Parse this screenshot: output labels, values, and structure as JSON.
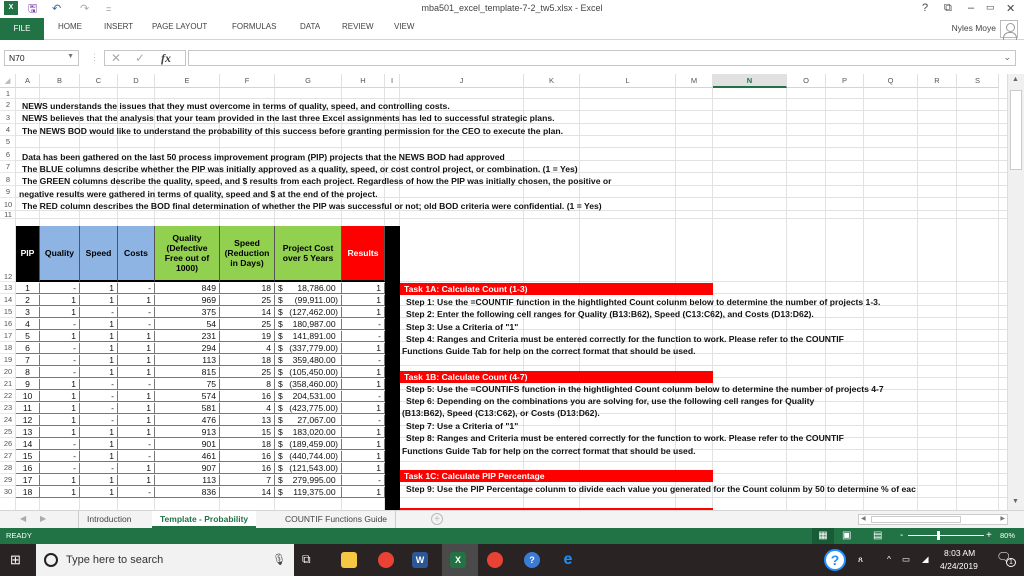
{
  "window": {
    "title": "mba501_excel_template-7-2_tw5.xlsx - Excel",
    "user_name": "Nyles Moye",
    "help": "?",
    "controls": {
      "restore_ribbon": "⧉",
      "minimize": "–",
      "maximize": "🗗",
      "close": "✕"
    }
  },
  "quick_access": {
    "save_icon": "save-icon",
    "undo_icon": "undo-icon",
    "redo_icon": "redo-icon",
    "customize": "="
  },
  "ribbon": {
    "tabs": [
      "FILE",
      "HOME",
      "INSERT",
      "PAGE LAYOUT",
      "FORMULAS",
      "DATA",
      "REVIEW",
      "VIEW"
    ]
  },
  "formula_bar": {
    "name_box": "N70",
    "cancel": "✕",
    "enter": "✓",
    "fx": "fx",
    "formula": ""
  },
  "columns": [
    "A",
    "B",
    "C",
    "D",
    "E",
    "F",
    "G",
    "H",
    "I",
    "J",
    "K",
    "L",
    "M",
    "N",
    "O",
    "P",
    "Q",
    "R",
    "S"
  ],
  "selected_column": "N",
  "rows": [
    "1",
    "2",
    "3",
    "4",
    "5",
    "6",
    "7",
    "8",
    "9",
    "10",
    "11",
    "12",
    "13",
    "14",
    "15",
    "16",
    "17",
    "18",
    "19",
    "20",
    "21",
    "22",
    "23",
    "24",
    "25",
    "26",
    "27",
    "28",
    "29",
    "30"
  ],
  "intro_lines": {
    "r2": "NEWS understands the issues that they must overcome in terms of quality, speed, and controlling costs.",
    "r3": "NEWS believes that the analysis that your team provided in the last three Excel assignments has led to successful strategic plans.",
    "r4": "The NEWS BOD would like to understand the probability of this success before granting permission for the CEO to execute the plan.",
    "r6": "Data has been gathered on the last 50 process improvement program (PIP) projects that the NEWS BOD had approved",
    "r7": "The BLUE columns describe whether the PIP was initially approved as a quality, speed, or cost control project, or combination. (1 = Yes)",
    "r8": "The GREEN columns describe the quality, speed, and $ results from each project. Regardless of how the PIP was initially chosen, the positive or",
    "r9": "negative results were gathered in terms of quality, speed and $ at the end of the project.",
    "r10": "The RED column describes the BOD final determination of whether the PIP was successful or not; old BOD criteria were confidential. (1 = Yes)"
  },
  "table": {
    "headers": {
      "pip": "PIP",
      "quality": "Quality",
      "speed": "Speed",
      "costs": "Costs",
      "quality_result": "Quality (Defective Free out of 1000)",
      "speed_result": "Speed (Reduction in Days)",
      "cost_result": "Project Cost over 5 Years",
      "results": "Results"
    },
    "colors": {
      "pip": "#000000",
      "blue": "#8db4e2",
      "green": "#92d050",
      "red": "#ff0000"
    },
    "rows": [
      {
        "pip": "1",
        "quality": "-",
        "speed": "1",
        "costs": "-",
        "q": "849",
        "s": "18",
        "cost_sym": "$",
        "cost": "18,786.00 ",
        "result": "1"
      },
      {
        "pip": "2",
        "quality": "1",
        "speed": "1",
        "costs": "1",
        "q": "969",
        "s": "25",
        "cost_sym": "$",
        "cost": "(99,911.00)",
        "result": "1"
      },
      {
        "pip": "3",
        "quality": "1",
        "speed": "-",
        "costs": "-",
        "q": "375",
        "s": "14",
        "cost_sym": "$",
        "cost": "(127,462.00)",
        "result": "1"
      },
      {
        "pip": "4",
        "quality": "-",
        "speed": "1",
        "costs": "-",
        "q": "54",
        "s": "25",
        "cost_sym": "$",
        "cost": "180,987.00 ",
        "result": "-"
      },
      {
        "pip": "5",
        "quality": "1",
        "speed": "1",
        "costs": "1",
        "q": "231",
        "s": "19",
        "cost_sym": "$",
        "cost": "141,891.00 ",
        "result": "-"
      },
      {
        "pip": "6",
        "quality": "-",
        "speed": "1",
        "costs": "1",
        "q": "294",
        "s": "4",
        "cost_sym": "$",
        "cost": "(337,779.00)",
        "result": "1"
      },
      {
        "pip": "7",
        "quality": "-",
        "speed": "1",
        "costs": "1",
        "q": "113",
        "s": "18",
        "cost_sym": "$",
        "cost": "359,480.00 ",
        "result": "-"
      },
      {
        "pip": "8",
        "quality": "-",
        "speed": "1",
        "costs": "1",
        "q": "815",
        "s": "25",
        "cost_sym": "$",
        "cost": "(105,450.00)",
        "result": "1"
      },
      {
        "pip": "9",
        "quality": "1",
        "speed": "-",
        "costs": "-",
        "q": "75",
        "s": "8",
        "cost_sym": "$",
        "cost": "(358,460.00)",
        "result": "1"
      },
      {
        "pip": "10",
        "quality": "1",
        "speed": "-",
        "costs": "1",
        "q": "574",
        "s": "16",
        "cost_sym": "$",
        "cost": "204,531.00 ",
        "result": "-"
      },
      {
        "pip": "11",
        "quality": "1",
        "speed": "-",
        "costs": "1",
        "q": "581",
        "s": "4",
        "cost_sym": "$",
        "cost": "(423,775.00)",
        "result": "1"
      },
      {
        "pip": "12",
        "quality": "1",
        "speed": "-",
        "costs": "1",
        "q": "476",
        "s": "13",
        "cost_sym": "$",
        "cost": "27,067.00 ",
        "result": "-"
      },
      {
        "pip": "13",
        "quality": "1",
        "speed": "1",
        "costs": "1",
        "q": "913",
        "s": "15",
        "cost_sym": "$",
        "cost": "183,020.00 ",
        "result": "1"
      },
      {
        "pip": "14",
        "quality": "-",
        "speed": "1",
        "costs": "-",
        "q": "901",
        "s": "18",
        "cost_sym": "$",
        "cost": "(189,459.00)",
        "result": "1"
      },
      {
        "pip": "15",
        "quality": "-",
        "speed": "1",
        "costs": "-",
        "q": "461",
        "s": "16",
        "cost_sym": "$",
        "cost": "(440,744.00)",
        "result": "1"
      },
      {
        "pip": "16",
        "quality": "-",
        "speed": "-",
        "costs": "1",
        "q": "907",
        "s": "16",
        "cost_sym": "$",
        "cost": "(121,543.00)",
        "result": "1"
      },
      {
        "pip": "17",
        "quality": "1",
        "speed": "1",
        "costs": "1",
        "q": "113",
        "s": "7",
        "cost_sym": "$",
        "cost": "279,995.00 ",
        "result": "-"
      },
      {
        "pip": "18",
        "quality": "1",
        "speed": "1",
        "costs": "-",
        "q": "836",
        "s": "14",
        "cost_sym": "$",
        "cost": "119,375.00 ",
        "result": "1"
      }
    ]
  },
  "tasks": {
    "t1a": {
      "title": "Task 1A:  Calculate Count (1-3)",
      "lines": [
        "Step 1: Use the =COUNTIF function in the hightlighted Count colunm below to determine the number of projects 1-3.",
        "Step 2: Enter the following cell ranges for Quality (B13:B62), Speed (C13:C62), and Costs (D13:D62).",
        "Step 3: Use a Criteria of \"1\"",
        "Step 4: Ranges and Criteria must be entered correctly for the function to work. Please refer to the COUNTIF",
        "Functions Guide Tab for help on the correct format that should be used."
      ]
    },
    "t1b": {
      "title": "Task 1B:  Calculate Count (4-7)",
      "lines": [
        "Step 5: Use the =COUNTIFS function in the hightlighted Count colunm below to determine the number of projects 4-7",
        "Step 6: Depending on the combinations you are solving for, use the following cell ranges for Quality",
        "(B13:B62), Speed (C13:C62), or Costs (D13:D62).",
        "Step 7: Use a Criteria of \"1\"",
        "Step 8: Ranges and Criteria must be entered correctly for the function to work. Please refer to the COUNTIF",
        "Functions Guide Tab for help on the correct format that should be used."
      ]
    },
    "t1c": {
      "title": "Task 1C:  Calculate PIP Percentage",
      "lines": [
        "Step 9: Use the PIP Percentage colunm to divide each value you generated for the Count colunm by 50 to determine % of eac"
      ]
    }
  },
  "sheet_tabs": [
    "Introduction",
    "Template - Probability",
    "COUNTIF Functions Guide"
  ],
  "active_sheet": "Template - Probability",
  "status_bar": {
    "mode": "READY",
    "zoom": "80%",
    "zoom_fraction": 0.8
  },
  "taskbar": {
    "search_placeholder": "Type here to search",
    "time": "8:03 AM",
    "date": "4/24/2019",
    "notifications": "1"
  }
}
